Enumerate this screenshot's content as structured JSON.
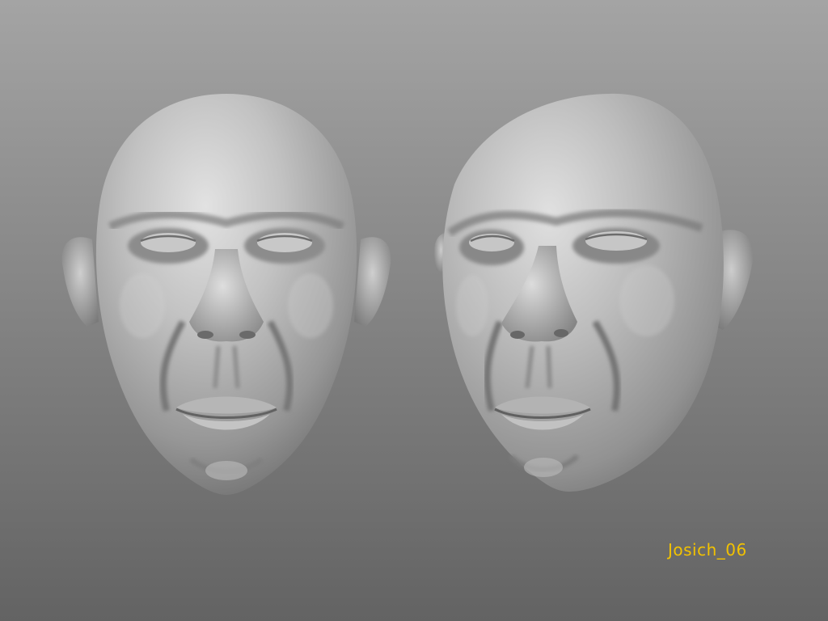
{
  "scene": {
    "background_top_color": "#a4a4a4",
    "background_bottom_color": "#636363",
    "material_color": "#a9a9a9"
  },
  "models": [
    {
      "name": "head-front-view",
      "view": "front"
    },
    {
      "name": "head-three-quarter-view",
      "view": "three-quarter-left"
    }
  ],
  "signature": {
    "text": "Josich_06",
    "color": "#f2c200"
  }
}
